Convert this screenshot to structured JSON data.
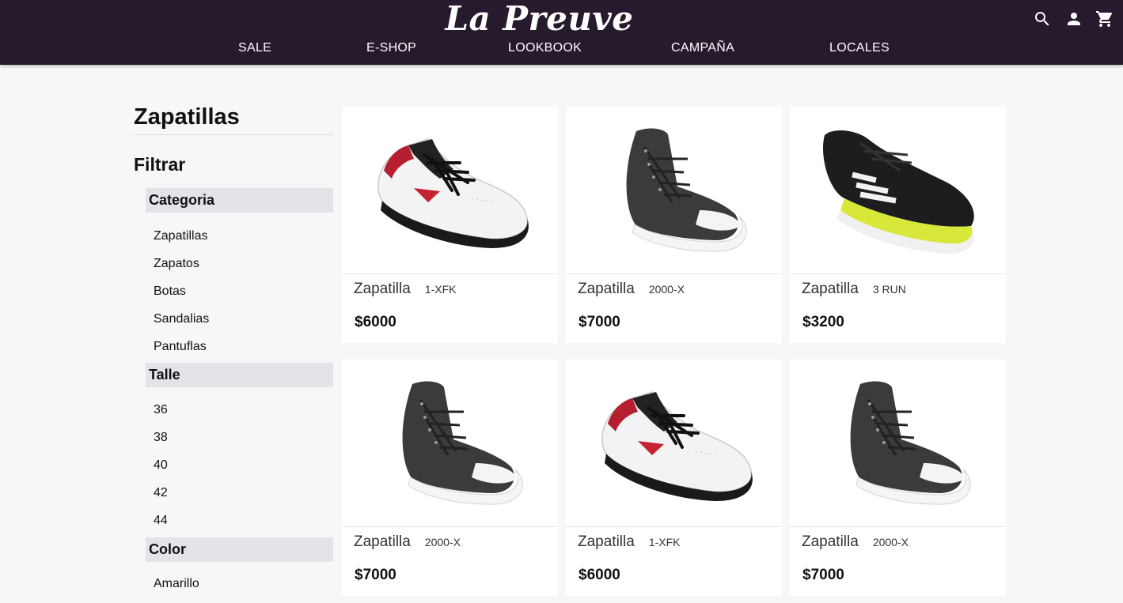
{
  "header": {
    "logo": "La Preuve",
    "nav": [
      "SALE",
      "E-SHOP",
      "LOOKBOOK",
      "CAMPAÑA",
      "LOCALES"
    ],
    "icons": [
      "search-icon",
      "account-icon",
      "cart-icon"
    ],
    "background": "#271a2d"
  },
  "sidebar": {
    "title": "Zapatillas",
    "filter_label": "Filtrar",
    "groups": [
      {
        "label": "Categoria",
        "items": [
          "Zapatillas",
          "Zapatos",
          "Botas",
          "Sandalias",
          "Pantuflas"
        ]
      },
      {
        "label": "Talle",
        "items": [
          "36",
          "38",
          "40",
          "42",
          "44"
        ]
      },
      {
        "label": "Color",
        "items": [
          "Amarillo"
        ]
      }
    ]
  },
  "products": [
    {
      "name": "Zapatilla",
      "model": "1-XFK",
      "price": "$6000",
      "image": "white-red-sneaker"
    },
    {
      "name": "Zapatilla",
      "model": "2000-X",
      "price": "$7000",
      "image": "black-high-top"
    },
    {
      "name": "Zapatilla",
      "model": "3 RUN",
      "price": "$3200",
      "image": "black-running-shoe"
    },
    {
      "name": "Zapatilla",
      "model": "2000-X",
      "price": "$7000",
      "image": "black-high-top"
    },
    {
      "name": "Zapatilla",
      "model": "1-XFK",
      "price": "$6000",
      "image": "white-red-sneaker"
    },
    {
      "name": "Zapatilla",
      "model": "2000-X",
      "price": "$7000",
      "image": "black-high-top"
    }
  ]
}
